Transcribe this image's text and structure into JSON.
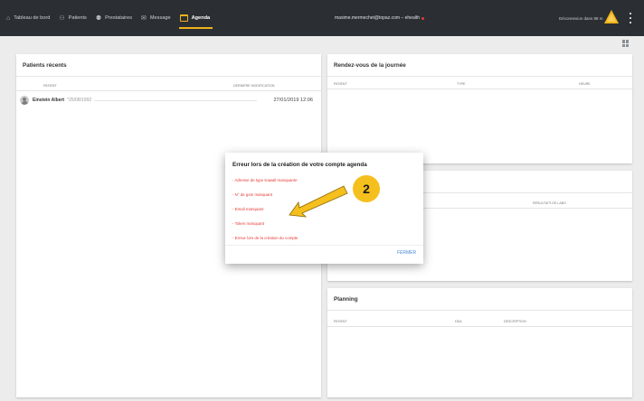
{
  "nav": {
    "items": [
      {
        "label": "Tableau de bord",
        "icon": "home-icon",
        "glyph": "⌂"
      },
      {
        "label": "Patients",
        "icon": "person-icon",
        "glyph": "⚇"
      },
      {
        "label": "Prestataires",
        "icon": "group-icon",
        "glyph": "⚉"
      },
      {
        "label": "Message",
        "icon": "mail-icon",
        "glyph": "✉"
      },
      {
        "label": "Agenda",
        "icon": "calendar-icon",
        "glyph": ""
      }
    ],
    "email": "maxime.mermechet@topaz.com – ehealth",
    "user_text": "Déconnexion dans 88 m"
  },
  "recent_patients": {
    "title": "Patients récents",
    "col_patient": "PATIENT",
    "col_modified": "DERNIÈRE MODIFICATION",
    "rows": [
      {
        "name": "Einstein Albert",
        "dob": "°25/08/1992",
        "modified": "27/01/2019 12:06"
      }
    ]
  },
  "appointments": {
    "title": "Rendez-vous de la journée",
    "col_patient": "PATIENT",
    "col_type": "TYPE",
    "col_time": "HEURE"
  },
  "lab_results": {
    "col_results": "RÉSULTATS DE LABO"
  },
  "planning": {
    "title": "Planning",
    "col_patient": "PATIENT",
    "col_date": "DDA",
    "col_desc": "DESCRIPTION"
  },
  "dialog": {
    "title": "Erreur lors de la création de votre compte agenda",
    "errors": [
      "- Adresse de type Kawall manquante",
      "- N° de gsm manquant",
      "- Email manquant",
      "- Token manquant",
      "- Erreur lors de la création du compte"
    ],
    "close_label": "FERMER"
  },
  "annotation": {
    "step": "2"
  },
  "colors": {
    "topbar": "#2b2f33",
    "accent": "#f2b31b",
    "error": "#e53935",
    "link": "#4a8bd6"
  }
}
